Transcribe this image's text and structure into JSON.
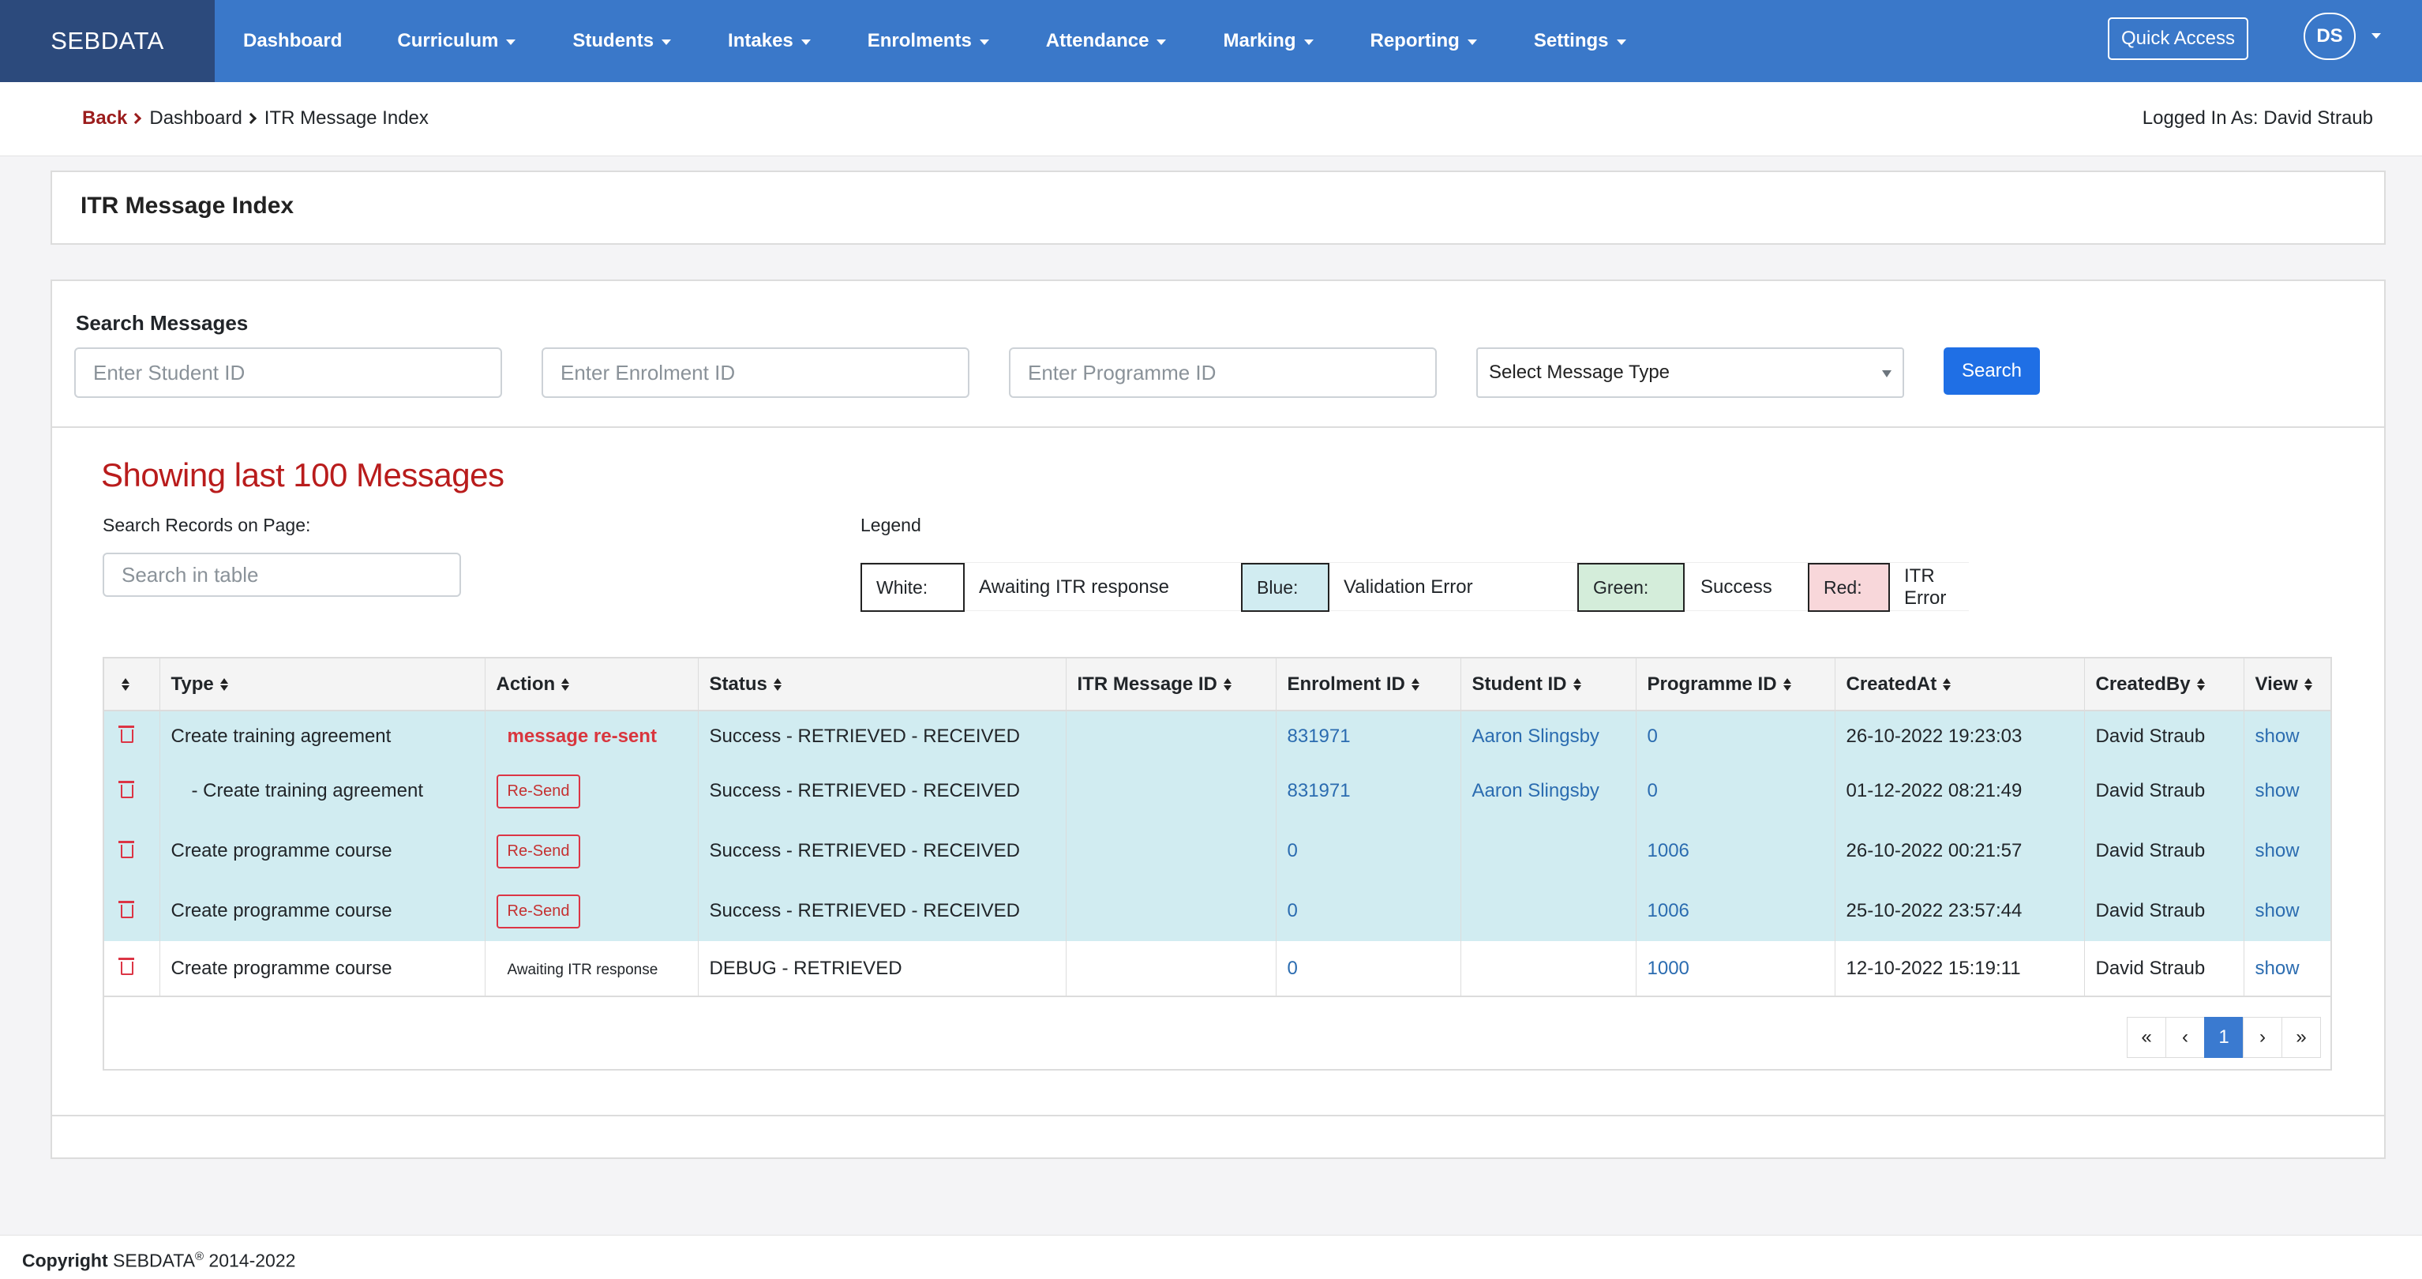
{
  "brand": "SEBDATA",
  "nav": {
    "dashboard": "Dashboard",
    "curriculum": "Curriculum",
    "students": "Students",
    "intakes": "Intakes",
    "enrolments": "Enrolments",
    "attendance": "Attendance",
    "marking": "Marking",
    "reporting": "Reporting",
    "settings": "Settings",
    "quick_access": "Quick Access",
    "avatar_initials": "DS"
  },
  "breadcrumb": {
    "back": "Back",
    "dashboard": "Dashboard",
    "current": "ITR Message Index"
  },
  "logged_in": "Logged In As: David Straub",
  "page_title": "ITR Message Index",
  "search": {
    "title": "Search Messages",
    "student_placeholder": "Enter Student ID",
    "enrolment_placeholder": "Enter Enrolment ID",
    "programme_placeholder": "Enter Programme ID",
    "message_type": "Select Message Type",
    "button": "Search"
  },
  "showing": "Showing last 100 Messages",
  "search_records_label": "Search Records on Page:",
  "table_search_placeholder": "Search in table",
  "legend": {
    "label": "Legend",
    "white": "White:",
    "white_desc": "Awaiting ITR response",
    "blue": "Blue:",
    "blue_desc": "Validation Error",
    "green": "Green:",
    "green_desc": "Success",
    "red": "Red:",
    "red_desc": "ITR Error"
  },
  "colors": {
    "nav": "#3a78c9",
    "brand": "#2c4a7c",
    "row_blue": "#d1ecf1",
    "legend_green": "#d4edda",
    "legend_red": "#f8d7da",
    "accent_red": "#b91c1c"
  },
  "table": {
    "headers": {
      "type": "Type",
      "action": "Action",
      "status": "Status",
      "itr_id": "ITR Message ID",
      "enrolment_id": "Enrolment ID",
      "student_id": "Student ID",
      "programme_id": "Programme ID",
      "created_at": "CreatedAt",
      "created_by": "CreatedBy",
      "view": "View"
    },
    "rows": [
      {
        "type": "Create training agreement",
        "action": "message re-sent",
        "status": "Success - RETRIEVED - RECEIVED",
        "itr_id": "",
        "enrolment_id": "831971",
        "student_id": "Aaron Slingsby",
        "programme_id": "0",
        "created_at": "26-10-2022 19:23:03",
        "created_by": "David Straub",
        "view": "show"
      },
      {
        "type": "- Create training agreement",
        "action": "Re-Send",
        "status": "Success - RETRIEVED - RECEIVED",
        "itr_id": "",
        "enrolment_id": "831971",
        "student_id": "Aaron Slingsby",
        "programme_id": "0",
        "created_at": "01-12-2022 08:21:49",
        "created_by": "David Straub",
        "view": "show"
      },
      {
        "type": "Create programme course",
        "action": "Re-Send",
        "status": "Success - RETRIEVED - RECEIVED",
        "itr_id": "",
        "enrolment_id": "0",
        "student_id": "",
        "programme_id": "1006",
        "created_at": "26-10-2022 00:21:57",
        "created_by": "David Straub",
        "view": "show"
      },
      {
        "type": "Create programme course",
        "action": "Re-Send",
        "status": "Success - RETRIEVED - RECEIVED",
        "itr_id": "",
        "enrolment_id": "0",
        "student_id": "",
        "programme_id": "1006",
        "created_at": "25-10-2022 23:57:44",
        "created_by": "David Straub",
        "view": "show"
      },
      {
        "type": "Create programme course",
        "action": "Awaiting ITR response",
        "status": "DEBUG - RETRIEVED",
        "itr_id": "",
        "enrolment_id": "0",
        "student_id": "",
        "programme_id": "1000",
        "created_at": "12-10-2022 15:19:11",
        "created_by": "David Straub",
        "view": "show"
      }
    ]
  },
  "pagination": {
    "first": "«",
    "prev": "‹",
    "current": "1",
    "next": "›",
    "last": "»"
  },
  "footer": {
    "copyright_label": "Copyright",
    "company": "SEBDATA",
    "reg": "®",
    "years": "2014-2022"
  }
}
